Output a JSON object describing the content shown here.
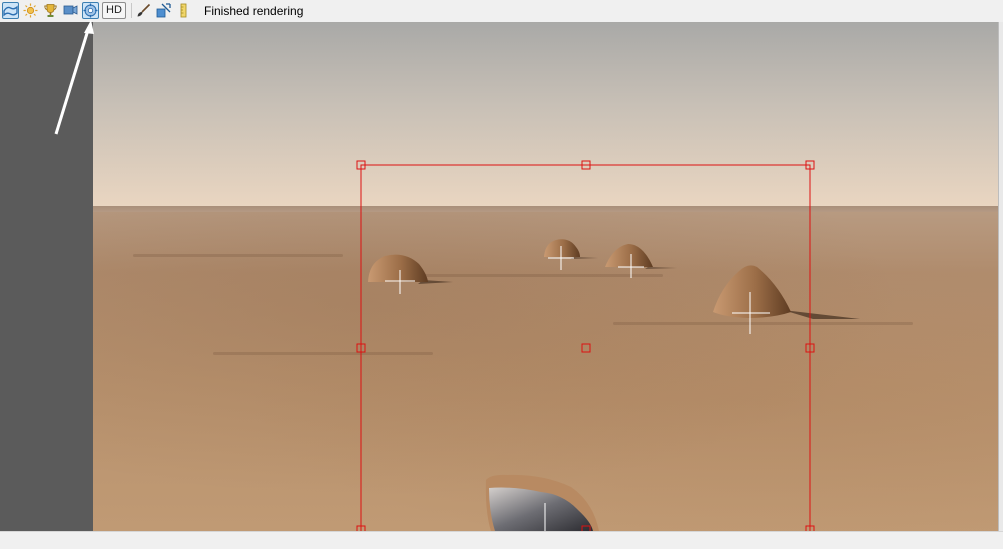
{
  "toolbar": {
    "buttons": [
      {
        "icon": "outline-view-icon",
        "active": true
      },
      {
        "icon": "sun-settings-icon",
        "active": false
      },
      {
        "icon": "trophy-icon",
        "active": false
      },
      {
        "icon": "camera-preview-icon",
        "active": false
      },
      {
        "icon": "render-options-icon",
        "active": true
      }
    ],
    "hd_label": "HD",
    "tools": [
      {
        "icon": "paint-brush-icon"
      },
      {
        "icon": "object-tool-icon"
      },
      {
        "icon": "ruler-icon"
      }
    ]
  },
  "status": {
    "text": "Finished rendering"
  },
  "scene": {
    "selection_box": {
      "color": "#dd1111"
    },
    "rocks": [
      {
        "name": "rock-1"
      },
      {
        "name": "rock-2"
      },
      {
        "name": "rock-3"
      },
      {
        "name": "rock-4"
      },
      {
        "name": "rock-5"
      }
    ]
  },
  "colors": {
    "toolbar_bg": "#f0f0f0",
    "left_panel": "#5b5b5b",
    "selection": "#dd1111",
    "active_button_border": "#3c7fb1"
  }
}
